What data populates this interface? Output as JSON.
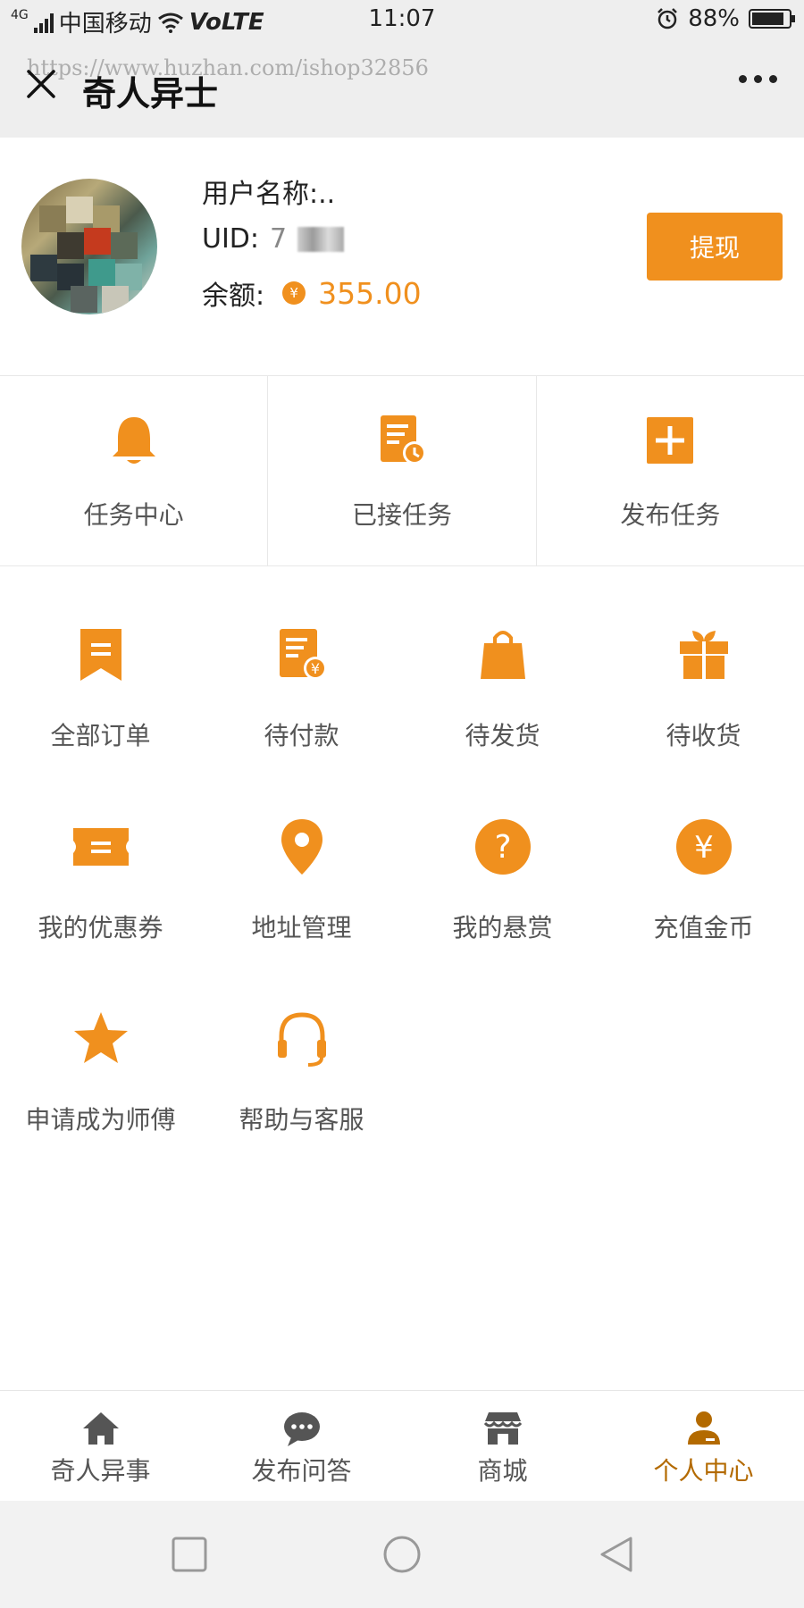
{
  "colors": {
    "accent": "#f0901e",
    "active_tab": "#b36a00",
    "header_bg": "#eeeeee"
  },
  "status_bar": {
    "network": "4G",
    "carrier": "中国移动",
    "volte": "VoLTE",
    "time": "11:07",
    "battery_percent": "88%",
    "battery_level": 0.88
  },
  "nav": {
    "title": "奇人异士",
    "watermark": "https://www.huzhan.com/ishop32856",
    "close_icon": "close-icon",
    "more_icon": "more-icon"
  },
  "profile": {
    "name_label": "用户名称:..",
    "uid_label": "UID:",
    "uid_value": "7",
    "balance_label": "余额:",
    "coin_symbol": "¥",
    "balance_value": "355.00",
    "withdraw_label": "提现"
  },
  "tasks": [
    {
      "label": "任务中心",
      "icon": "bell-icon"
    },
    {
      "label": "已接任务",
      "icon": "task-clock-icon"
    },
    {
      "label": "发布任务",
      "icon": "plus-icon"
    }
  ],
  "grid": [
    {
      "label": "全部订单",
      "icon": "bookmark-icon"
    },
    {
      "label": "待付款",
      "icon": "bill-yen-icon"
    },
    {
      "label": "待发货",
      "icon": "bag-icon"
    },
    {
      "label": "待收货",
      "icon": "gift-icon"
    },
    {
      "label": "我的优惠券",
      "icon": "coupon-icon"
    },
    {
      "label": "地址管理",
      "icon": "location-icon"
    },
    {
      "label": "我的悬赏",
      "icon": "question-icon"
    },
    {
      "label": "充值金币",
      "icon": "yen-coin-icon"
    },
    {
      "label": "申请成为师傅",
      "icon": "star-icon"
    },
    {
      "label": "帮助与客服",
      "icon": "headset-icon"
    }
  ],
  "tabs": [
    {
      "label": "奇人异事",
      "icon": "home-icon"
    },
    {
      "label": "发布问答",
      "icon": "chat-icon"
    },
    {
      "label": "商城",
      "icon": "store-icon"
    },
    {
      "label": "个人中心",
      "icon": "user-icon",
      "active": true
    }
  ],
  "system_nav": [
    "square-icon",
    "circle-icon",
    "back-triangle-icon"
  ]
}
